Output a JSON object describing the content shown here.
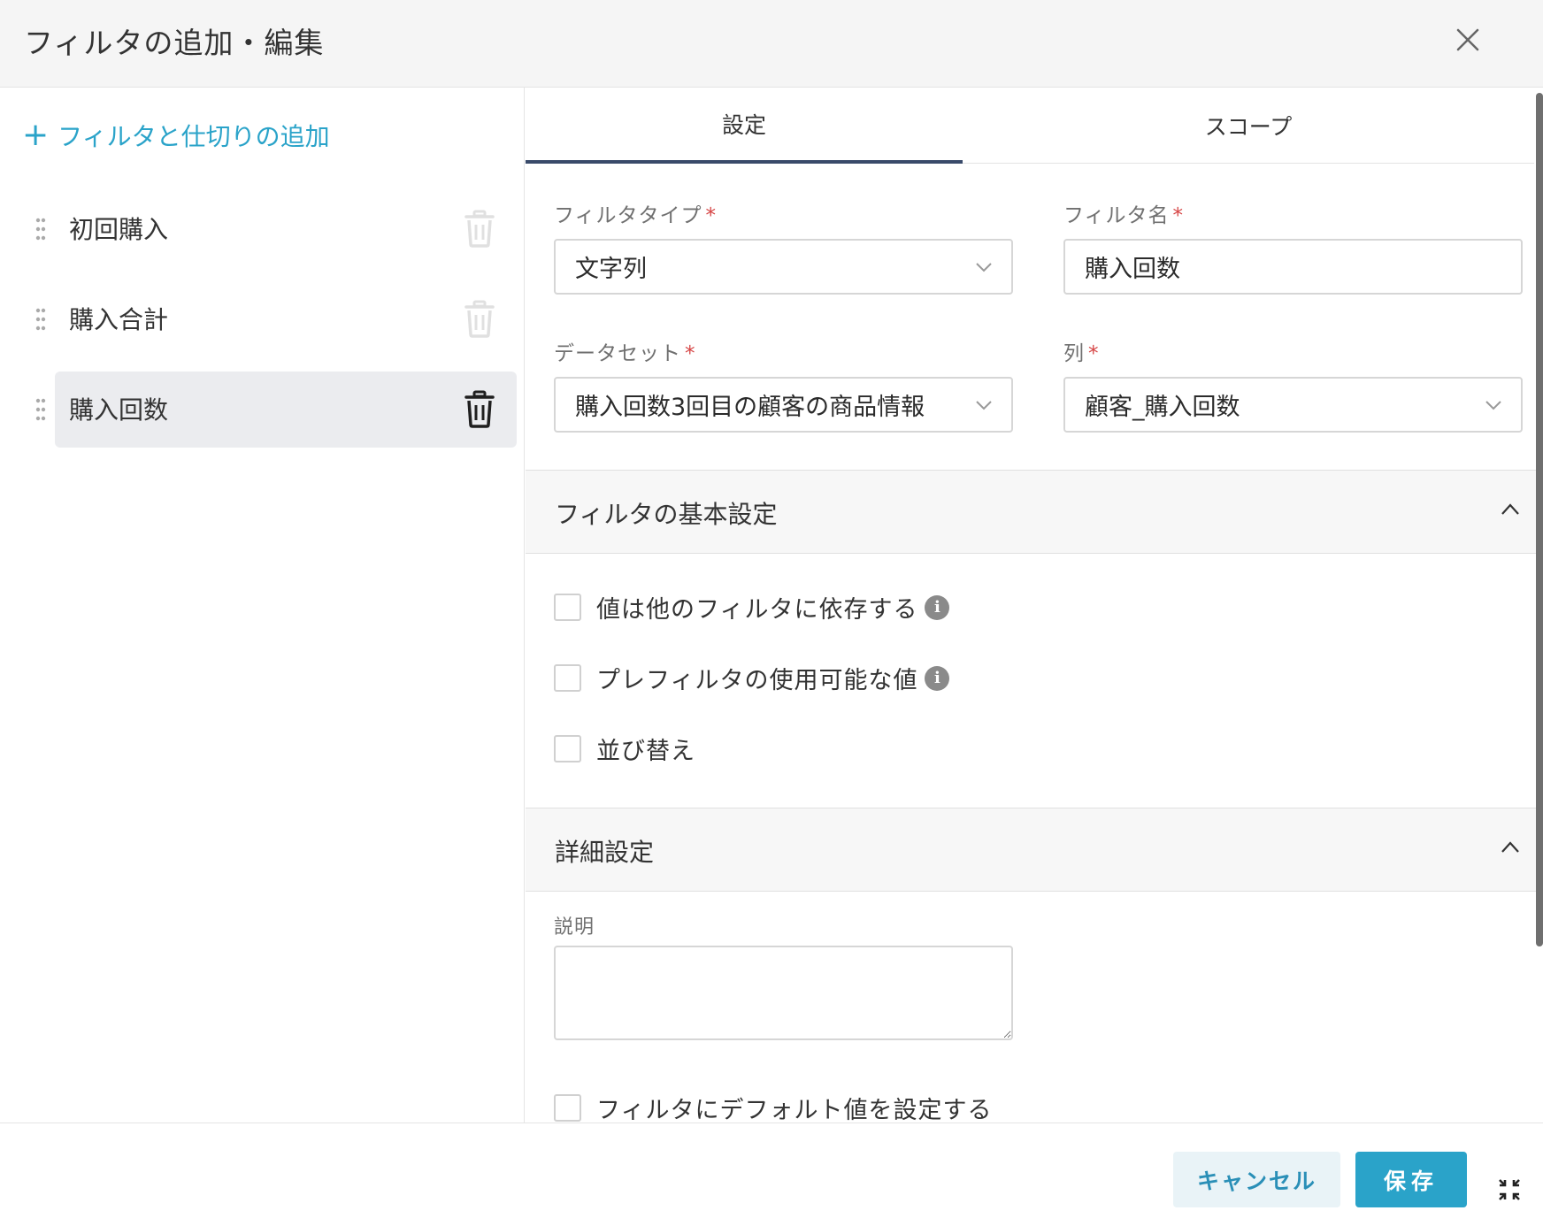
{
  "dialog": {
    "title": "フィルタの追加・編集"
  },
  "left": {
    "add_label": "フィルタと仕切りの追加",
    "items": [
      {
        "label": "初回購入",
        "active": false
      },
      {
        "label": "購入合計",
        "active": false
      },
      {
        "label": "購入回数",
        "active": true
      }
    ]
  },
  "tabs": [
    {
      "label": "設定",
      "active": true
    },
    {
      "label": "スコープ",
      "active": false
    }
  ],
  "form": {
    "filter_type": {
      "label": "フィルタタイプ",
      "required": "*",
      "value": "文字列"
    },
    "filter_name": {
      "label": "フィルタ名",
      "required": "*",
      "value": "購入回数"
    },
    "dataset": {
      "label": "データセット",
      "required": "*",
      "value": "購入回数3回目の顧客の商品情報"
    },
    "column": {
      "label": "列",
      "required": "*",
      "value": "顧客_購入回数"
    }
  },
  "basic_section": {
    "title": "フィルタの基本設定",
    "options": [
      {
        "label": "値は他のフィルタに依存する",
        "info": true,
        "checked": false
      },
      {
        "label": "プレフィルタの使用可能な値",
        "info": true,
        "checked": false
      },
      {
        "label": "並び替え",
        "info": false,
        "checked": false
      }
    ]
  },
  "detail_section": {
    "title": "詳細設定",
    "description_label": "説明",
    "description_value": "",
    "default_value_label": "フィルタにデフォルト値を設定する"
  },
  "footer": {
    "cancel_label": "キャンセル",
    "save_label": "保存"
  },
  "colors": {
    "accent": "#2aa3c9",
    "tab_underline": "#394a6a",
    "required": "#d64545"
  },
  "icons": {
    "info_glyph": "i"
  }
}
